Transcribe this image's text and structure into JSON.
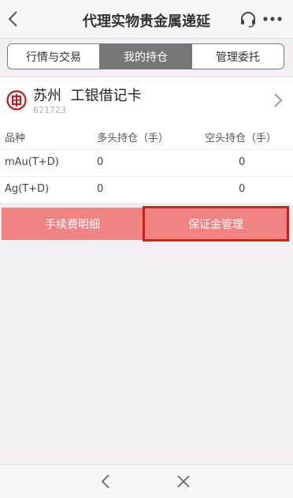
{
  "header": {
    "title": "代理实物贵金属递延",
    "back_icon": "chevron-left-icon",
    "support_icon": "headset-icon",
    "more_icon": "more-dots-icon"
  },
  "tabs": [
    {
      "label": "行情与交易",
      "active": false
    },
    {
      "label": "我的持仓",
      "active": true
    },
    {
      "label": "管理委托",
      "active": false
    }
  ],
  "account": {
    "name": "苏州  工银借记卡",
    "number": "621723",
    "logo_icon": "icbc-logo-icon",
    "chevron_icon": "chevron-right-icon"
  },
  "positions": {
    "columns": [
      "品种",
      "多头持仓（手）",
      "空头持仓（手）"
    ],
    "rows": [
      {
        "product": "mAu(T+D)",
        "long": "0",
        "short": "0"
      },
      {
        "product": "Ag(T+D)",
        "long": "0",
        "short": "0"
      }
    ]
  },
  "actions": {
    "fee_details": "手续费明细",
    "margin_management": "保证金管理"
  },
  "colors": {
    "accent": "#f08383",
    "highlight_border": "#e01818",
    "tab_active": "#777777"
  },
  "footer": {
    "back_icon": "chevron-left-icon",
    "close_icon": "close-icon"
  }
}
